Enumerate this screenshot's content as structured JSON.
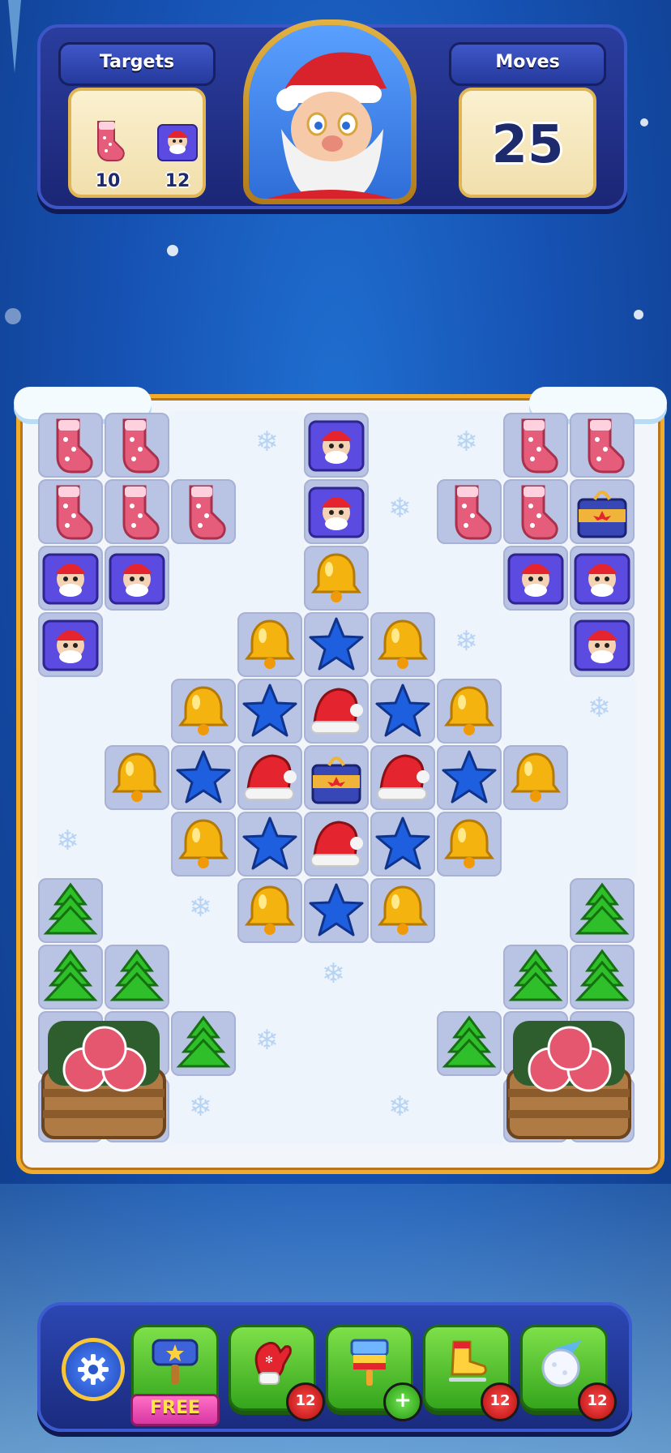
{
  "hud": {
    "targets_label": "Targets",
    "moves_label": "Moves",
    "moves_value": "25",
    "targets": [
      {
        "icon": "sock-icon",
        "count": "10"
      },
      {
        "icon": "santa-box-icon",
        "count": "12"
      }
    ]
  },
  "boosters": [
    {
      "name": "hammer-booster",
      "icon": "hammer-icon",
      "label": "FREE"
    },
    {
      "name": "mitten-booster",
      "icon": "mitten-icon",
      "count": "12"
    },
    {
      "name": "brush-booster",
      "icon": "brush-icon",
      "count": "+"
    },
    {
      "name": "skate-booster",
      "icon": "ice-skate-icon",
      "count": "12"
    },
    {
      "name": "snowball-booster",
      "icon": "snowball-icon",
      "count": "12"
    }
  ],
  "board": {
    "columns": 9,
    "rows": 11,
    "pieces": [
      [
        "sock",
        "sock",
        null,
        null,
        "santabox",
        null,
        null,
        "sock",
        "sock"
      ],
      [
        "sock",
        "sock",
        "sock",
        null,
        "santabox",
        null,
        "sock",
        "sock",
        "gift"
      ],
      [
        "santabox",
        "santabox",
        null,
        null,
        "bell",
        null,
        null,
        "santabox",
        "santabox"
      ],
      [
        "santabox",
        null,
        null,
        "bell",
        "star",
        "bell",
        null,
        null,
        "santabox"
      ],
      [
        null,
        null,
        "bell",
        "star",
        "hat",
        "star",
        "bell",
        null,
        null
      ],
      [
        null,
        "bell",
        "star",
        "hat",
        "gift",
        "hat",
        "star",
        "bell",
        null
      ],
      [
        null,
        null,
        "bell",
        "star",
        "hat",
        "star",
        "bell",
        null,
        null
      ],
      [
        "tree",
        null,
        null,
        "bell",
        "star",
        "bell",
        null,
        null,
        "tree"
      ],
      [
        "tree",
        "tree",
        null,
        null,
        null,
        null,
        null,
        "tree",
        "tree"
      ],
      [
        "basket",
        "basket",
        "tree",
        null,
        null,
        null,
        "tree",
        "basket",
        "basket"
      ],
      [
        "basket",
        "basket",
        null,
        null,
        null,
        null,
        null,
        "basket",
        "basket"
      ]
    ]
  },
  "colors": {
    "bell": "#f4b30f",
    "star": "#1e5fe0",
    "hat": "#e4252f",
    "tree": "#2fbf2a",
    "sock": "#e65c7b",
    "frame": "#f3ac2a"
  }
}
